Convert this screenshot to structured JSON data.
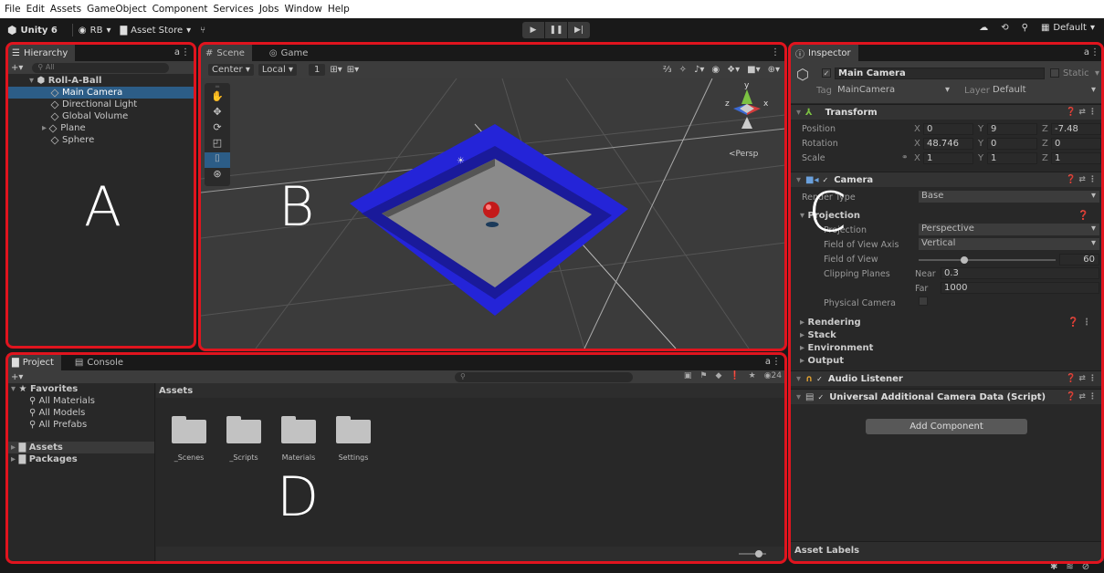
{
  "menu": [
    "File",
    "Edit",
    "Assets",
    "GameObject",
    "Component",
    "Services",
    "Jobs",
    "Window",
    "Help"
  ],
  "toolbar": {
    "app": "Unity 6",
    "account": "RB",
    "asset_store": "Asset Store",
    "layout": "Default"
  },
  "hierarchy": {
    "tab": "Hierarchy",
    "search_placeholder": "All",
    "scene": "Roll-A-Ball",
    "items": [
      "Main Camera",
      "Directional Light",
      "Global Volume",
      "Plane",
      "Sphere"
    ]
  },
  "scene": {
    "tab_scene": "Scene",
    "tab_game": "Game",
    "pivot": "Center",
    "space": "Local",
    "snap": "1",
    "persp": "Persp",
    "gizmo_y": "y",
    "gizmo_x": "x",
    "gizmo_z": "z"
  },
  "inspector": {
    "tab": "Inspector",
    "object_name": "Main Camera",
    "static": "Static",
    "tag_label": "Tag",
    "tag": "MainCamera",
    "layer_label": "Layer",
    "layer": "Default",
    "transform": {
      "title": "Transform",
      "position_label": "Position",
      "rotation_label": "Rotation",
      "scale_label": "Scale",
      "position": {
        "x": "0",
        "y": "9",
        "z": "-7.48"
      },
      "rotation": {
        "x": "48.746",
        "y": "0",
        "z": "0"
      },
      "scale": {
        "x": "1",
        "y": "1",
        "z": "1"
      }
    },
    "camera": {
      "title": "Camera",
      "render_type_label": "Render Type",
      "render_type": "Base",
      "projection_section": "Projection",
      "projection_label": "Projection",
      "projection": "Perspective",
      "fov_axis_label": "Field of View Axis",
      "fov_axis": "Vertical",
      "fov_label": "Field of View",
      "fov": "60",
      "fov_fraction": 0.33,
      "clipping_label": "Clipping Planes",
      "near_label": "Near",
      "near": "0.3",
      "far_label": "Far",
      "far": "1000",
      "physical_label": "Physical Camera",
      "sections": [
        "Rendering",
        "Stack",
        "Environment",
        "Output"
      ]
    },
    "audio_listener": "Audio Listener",
    "urp_data": "Universal Additional Camera Data (Script)",
    "add_component": "Add Component",
    "asset_labels": "Asset Labels"
  },
  "project": {
    "tab_project": "Project",
    "tab_console": "Console",
    "count": "24",
    "favorites": "Favorites",
    "fav_items": [
      "All Materials",
      "All Models",
      "All Prefabs"
    ],
    "roots": [
      "Assets",
      "Packages"
    ],
    "assets_header": "Assets",
    "folders": [
      "_Scenes",
      "_Scripts",
      "Materials",
      "Settings"
    ]
  },
  "annotations": {
    "a": "A",
    "b": "B",
    "c": "C",
    "d": "D"
  },
  "colors": {
    "accent_red": "#e0141e",
    "selection": "#2c5d87",
    "wall_blue": "#2a2ad6"
  }
}
